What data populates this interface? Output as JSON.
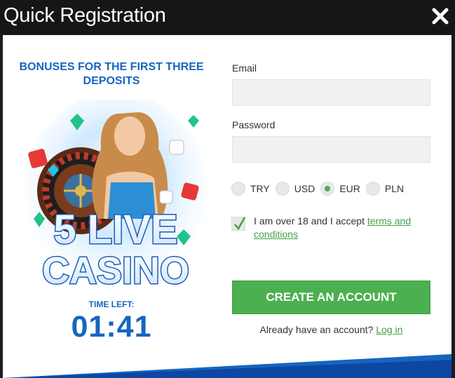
{
  "header": {
    "title": "Quick Registration",
    "close_icon": "close-icon"
  },
  "promo": {
    "bonus_title": "BONUSES FOR THE FIRST THREE DEPOSITS",
    "banner_line1": "5 LIVE",
    "banner_line2": "CASINO",
    "time_label": "TIME LEFT:",
    "timer": "01:41"
  },
  "form": {
    "email_label": "Email",
    "email_value": "",
    "password_label": "Password",
    "password_value": "",
    "currencies": [
      {
        "label": "TRY",
        "selected": false
      },
      {
        "label": "USD",
        "selected": false
      },
      {
        "label": "EUR",
        "selected": true
      },
      {
        "label": "PLN",
        "selected": false
      }
    ],
    "agree_text": "I am over 18 and I accept ",
    "terms_link": "terms and conditions",
    "agree_checked": true,
    "create_button": "CREATE AN ACCOUNT",
    "login_prompt": "Already have an account?",
    "login_link": "Log in"
  },
  "colors": {
    "accent_green": "#4caf50",
    "brand_blue": "#1565c0",
    "header_bg": "#161616"
  }
}
